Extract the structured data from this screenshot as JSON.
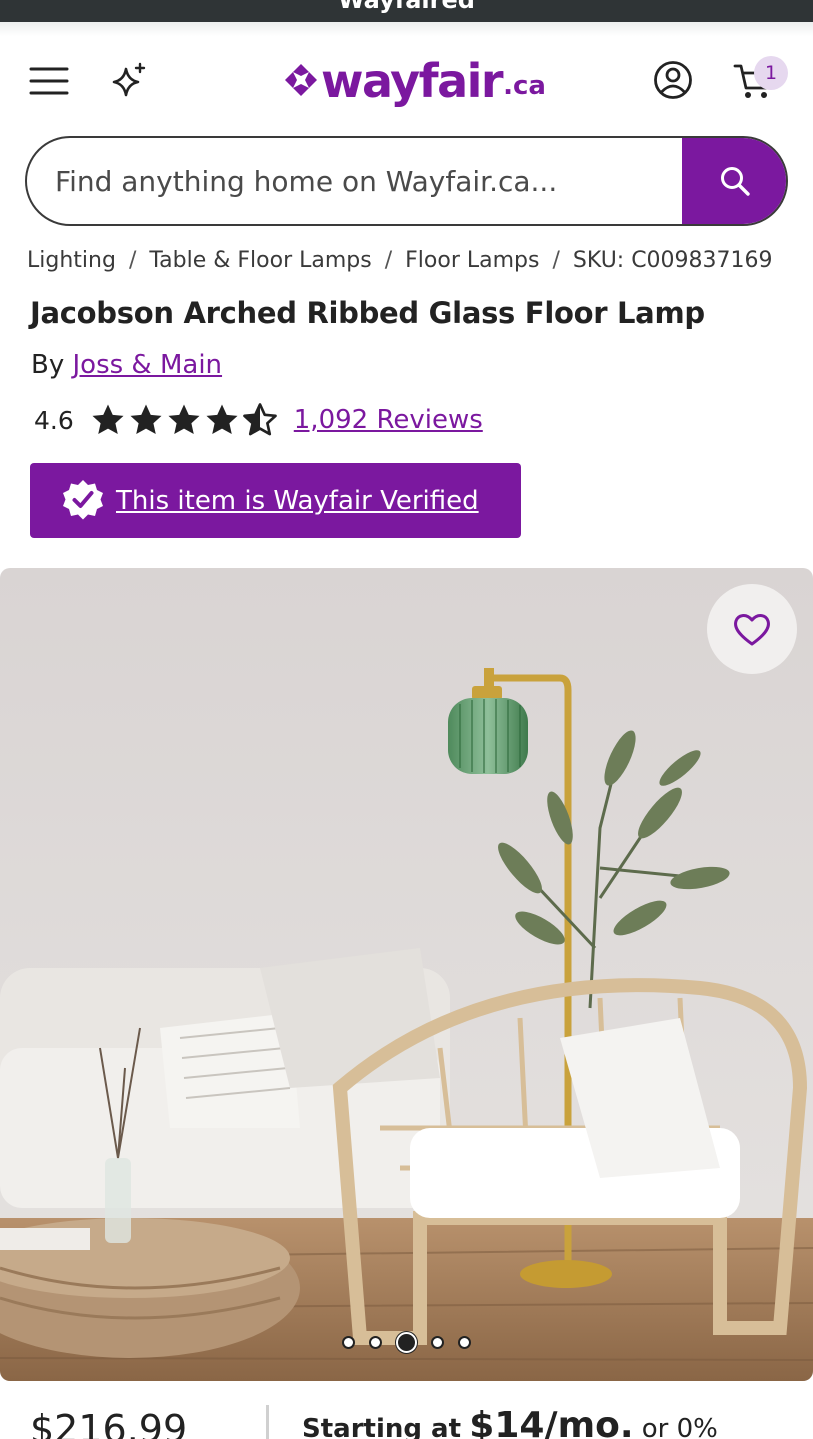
{
  "top_banner": {
    "text": "Wayfaired"
  },
  "header": {
    "logo_word": "wayfair",
    "logo_tld": ".ca",
    "cart_count": "1"
  },
  "search": {
    "placeholder": "Find anything home on Wayfair.ca..."
  },
  "breadcrumb": {
    "items": [
      "Lighting",
      "Table & Floor Lamps",
      "Floor Lamps"
    ],
    "sku": "SKU: C009837169"
  },
  "product": {
    "title": "Jacobson Arched Ribbed Glass Floor Lamp",
    "by_label": "By",
    "brand": "Joss & Main",
    "rating": "4.6",
    "rating_value": 4.6,
    "reviews": "1,092 Reviews",
    "verified": "This item is Wayfair Verified"
  },
  "gallery": {
    "image_count": 5,
    "active_index": 2
  },
  "pricing": {
    "price": "$216.99",
    "starting_at": "Starting at",
    "monthly": "$14/mo.",
    "suffix": "or 0%"
  },
  "colors": {
    "brand": "#7b189f",
    "topbar": "#2f3436"
  },
  "icons": [
    "menu-icon",
    "sparkle-icon",
    "account-icon",
    "cart-icon",
    "search-icon",
    "star-icon",
    "verified-badge-icon",
    "heart-icon"
  ]
}
